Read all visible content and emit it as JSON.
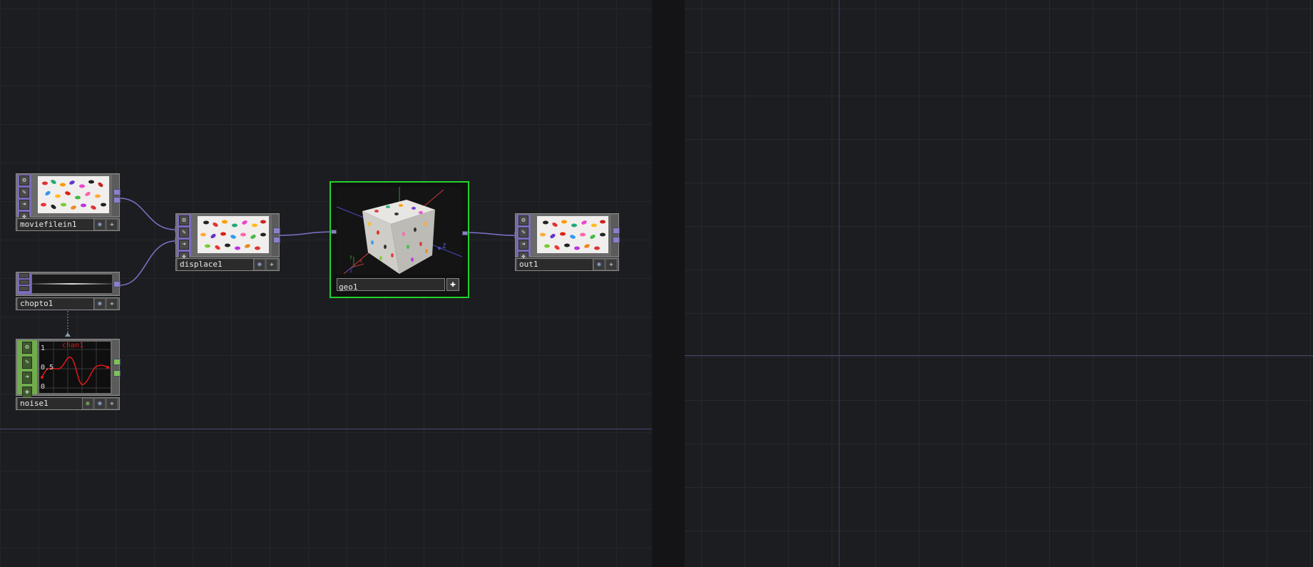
{
  "network": {
    "nodes": {
      "moviefilein1": {
        "name": "moviefilein1",
        "family": "TOP"
      },
      "displace1": {
        "name": "displace1",
        "family": "TOP"
      },
      "chopto1": {
        "name": "chopto1",
        "family": "TOP"
      },
      "noise1": {
        "name": "noise1",
        "family": "CHOP",
        "graph": {
          "channel": "chan1",
          "y_labels": [
            "1",
            "0.5",
            "0"
          ]
        }
      },
      "geo1": {
        "name": "geo1",
        "family": "COMP",
        "axis_label": "Z",
        "gizmo_labels": [
          "y",
          "x",
          "z"
        ]
      },
      "out1": {
        "name": "out1",
        "family": "TOP"
      }
    },
    "colors": {
      "top_strip": "#7b6bbc",
      "chop_strip": "#6fae4a",
      "wire": "#7f72c9",
      "selected_border": "#22d22a",
      "background": "#1c1d21"
    },
    "icons": {
      "node_buttons": [
        "gear-icon",
        "pen-icon",
        "arrow-right-icon",
        "paint-icon"
      ],
      "label_buttons": [
        "viewer-icon",
        "plus-icon"
      ]
    }
  }
}
